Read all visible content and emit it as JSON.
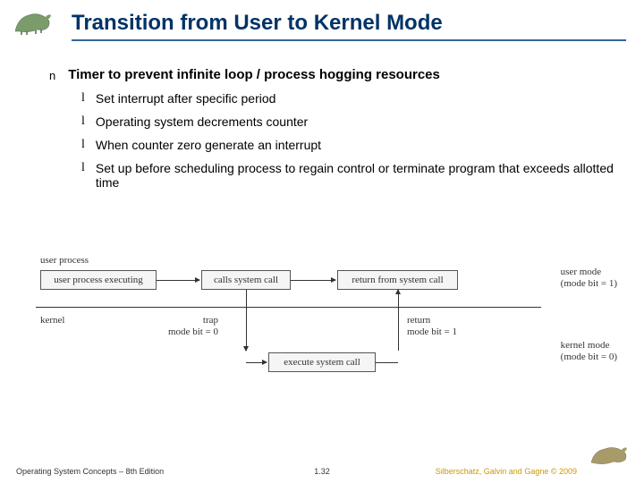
{
  "title": "Transition from User to Kernel Mode",
  "main_bullet": "Timer to prevent infinite loop / process hogging resources",
  "sub_bullets": [
    "Set interrupt after specific period",
    "Operating system decrements counter",
    "When counter zero generate an interrupt",
    "Set up before scheduling process to regain control or terminate program that exceeds allotted time"
  ],
  "diagram": {
    "user_process": "user process",
    "box_user_exec": "user process executing",
    "box_calls": "calls system call",
    "box_return": "return from system call",
    "user_mode_l1": "user mode",
    "user_mode_l2": "(mode bit = 1)",
    "kernel": "kernel",
    "trap_l1": "trap",
    "trap_l2": "mode bit = 0",
    "return_l1": "return",
    "return_l2": "mode bit = 1",
    "box_execute": "execute system call",
    "kernel_mode_l1": "kernel mode",
    "kernel_mode_l2": "(mode bit = 0)"
  },
  "footer": {
    "left": "Operating System Concepts – 8th Edition",
    "center": "1.32",
    "right": "Silberschatz, Galvin and Gagne © 2009"
  }
}
